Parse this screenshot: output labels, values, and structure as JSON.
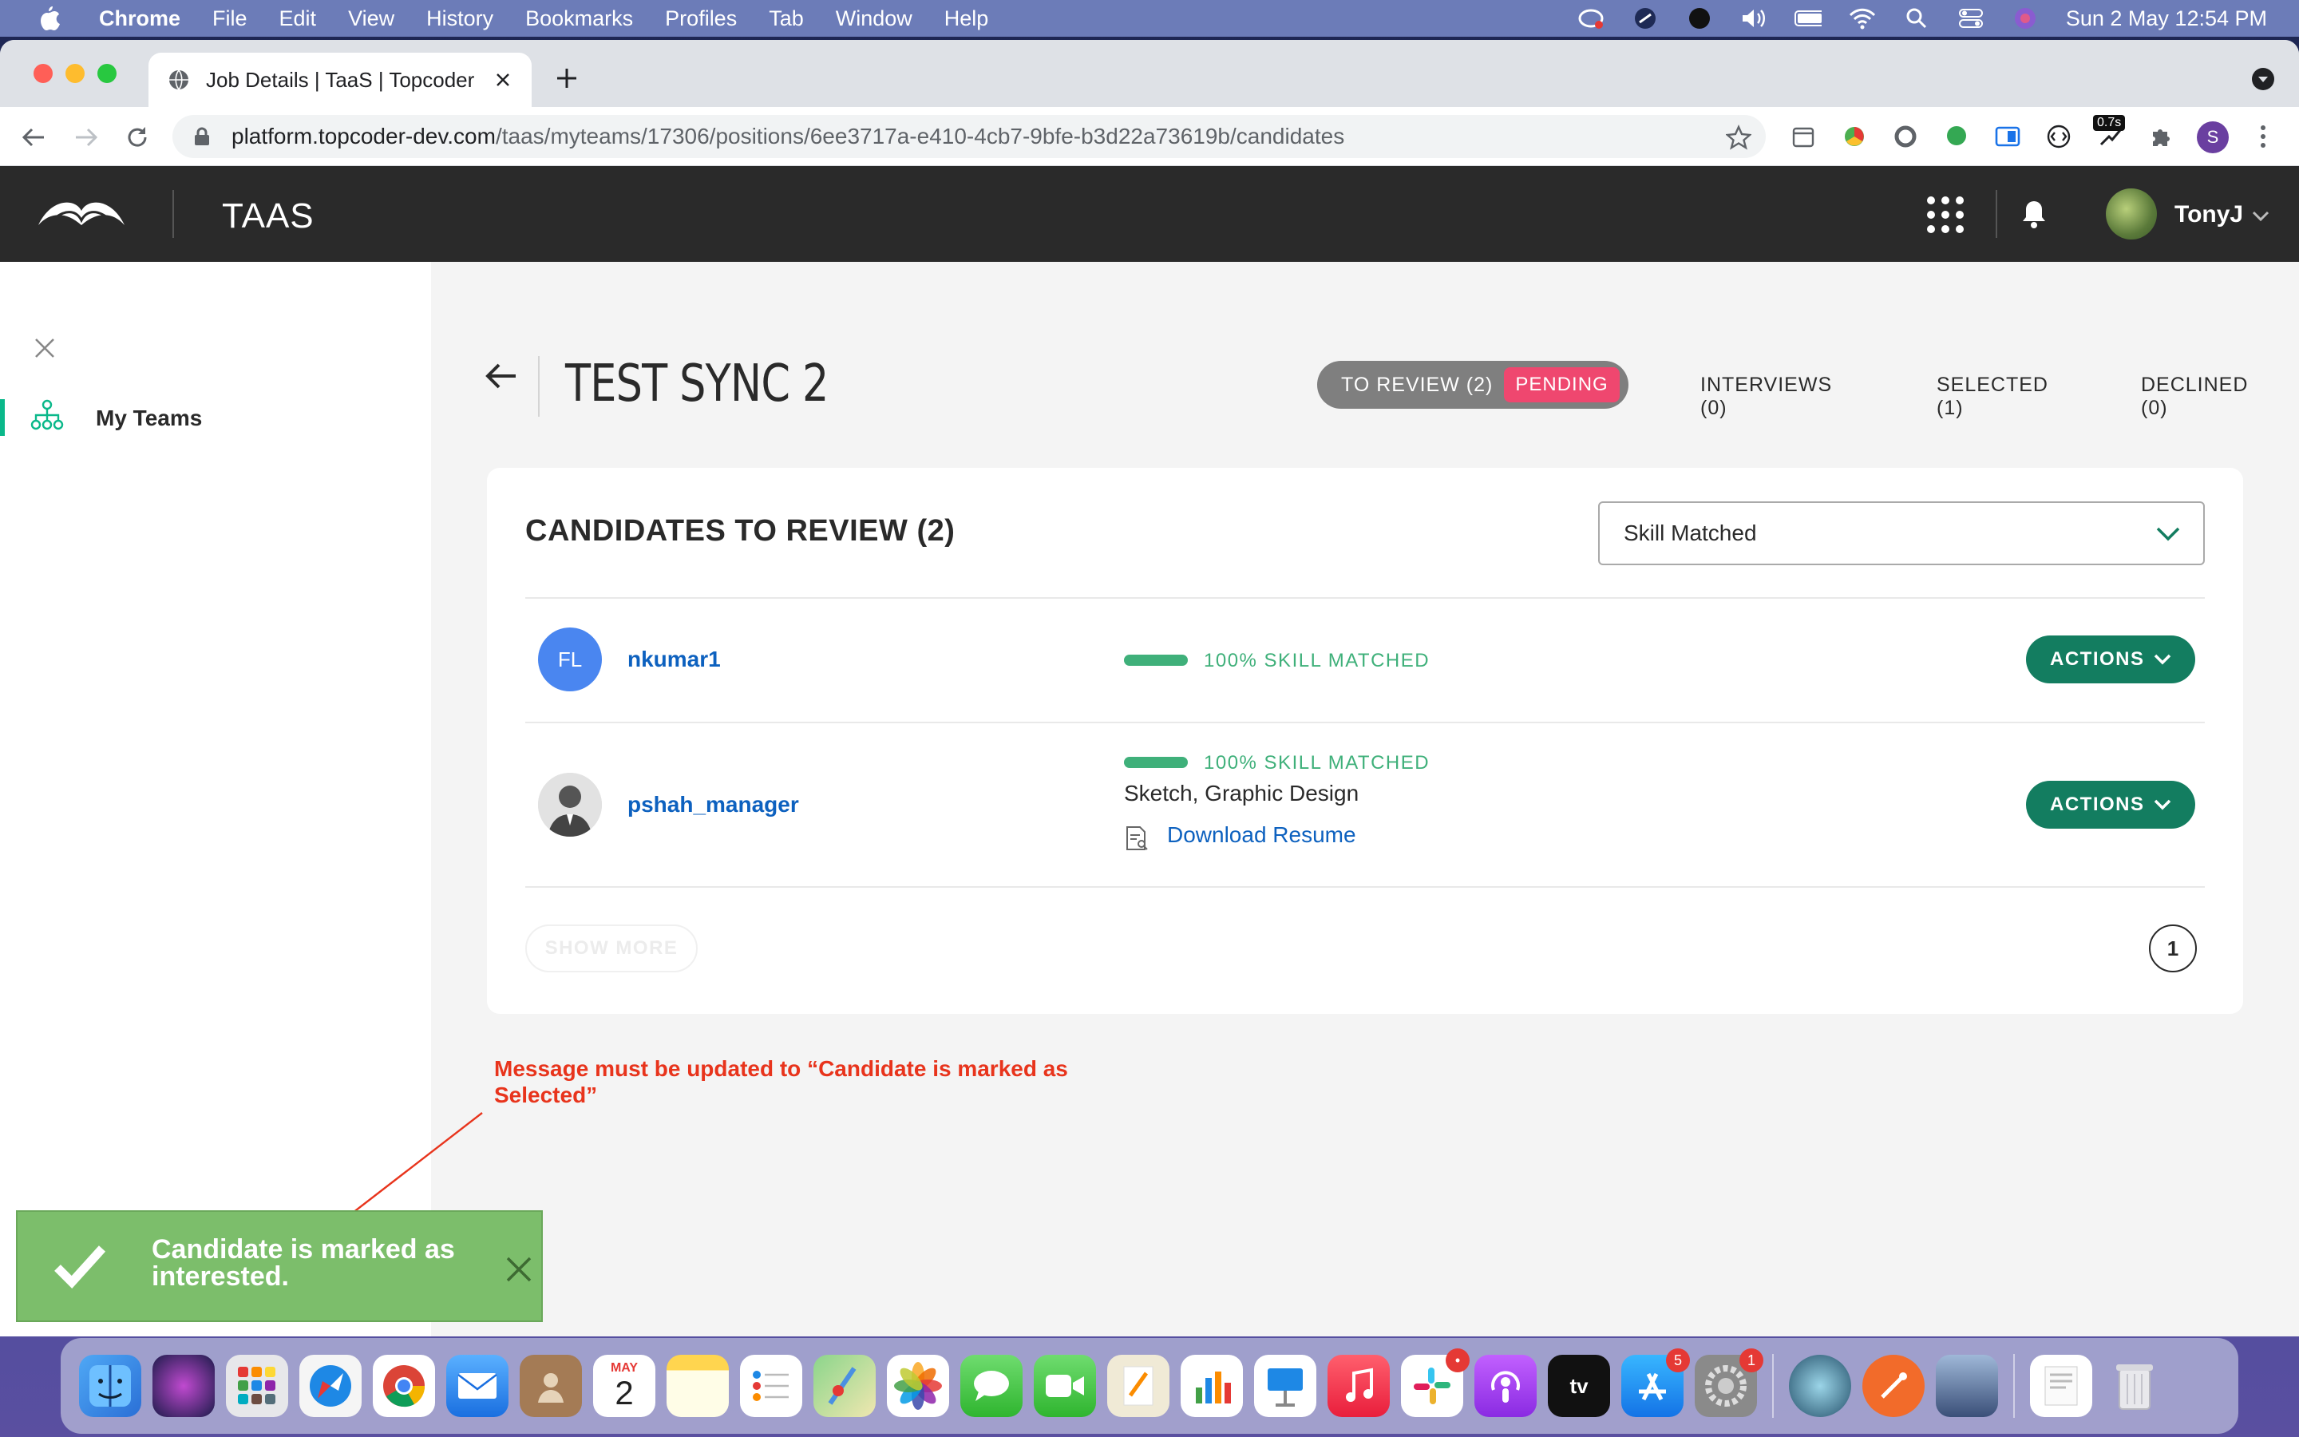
{
  "menubar": {
    "app": "Chrome",
    "items": [
      "File",
      "Edit",
      "View",
      "History",
      "Bookmarks",
      "Profiles",
      "Tab",
      "Window",
      "Help"
    ],
    "datetime": "Sun 2 May  12:54 PM"
  },
  "browser": {
    "tab_title": "Job Details | TaaS | Topcoder",
    "url_host": "platform.topcoder-dev.com",
    "url_path": "/taas/myteams/17306/positions/6ee3717a-e410-4cb7-9bfe-b3d22a73619b/candidates",
    "ext_badge": "0.7s",
    "profile_initial": "S"
  },
  "header": {
    "app_title": "TAAS",
    "user_name": "TonyJ"
  },
  "sidebar": {
    "items": [
      {
        "label": "My Teams"
      }
    ]
  },
  "page": {
    "title": "TEST SYNC 2",
    "tabs": {
      "review": "TO REVIEW (2)",
      "pending": "PENDING",
      "interviews": "INTERVIEWS (0)",
      "selected": "SELECTED (1)",
      "declined": "DECLINED (0)"
    },
    "card_title": "CANDIDATES TO REVIEW (2)",
    "sort_value": "Skill Matched",
    "candidates": [
      {
        "initials": "FL",
        "handle": "nkumar1",
        "skill_match": "100% SKILL MATCHED",
        "skill_fraction": 1.0,
        "actions": "ACTIONS"
      },
      {
        "handle": "pshah_manager",
        "skill_match": "100% SKILL MATCHED",
        "skill_fraction": 1.0,
        "skills": "Sketch, Graphic Design",
        "resume": "Download Resume",
        "actions": "ACTIONS"
      }
    ],
    "show_more": "SHOW MORE",
    "page_number": "1"
  },
  "annotation": {
    "text": "Message must be updated to “Candidate is marked as Selected”",
    "color": "#e8341c"
  },
  "toast": {
    "message": "Candidate is marked as interested.",
    "color": "#7cbe6b"
  },
  "dock": {
    "calendar_month": "MAY",
    "calendar_day": "2",
    "badges": {
      "appstore": "5",
      "settings": "1"
    }
  },
  "colors": {
    "accent_green": "#137d60",
    "link_blue": "#0d61bf",
    "pending_pink": "#ef476f",
    "skill_green": "#3fb07a"
  }
}
